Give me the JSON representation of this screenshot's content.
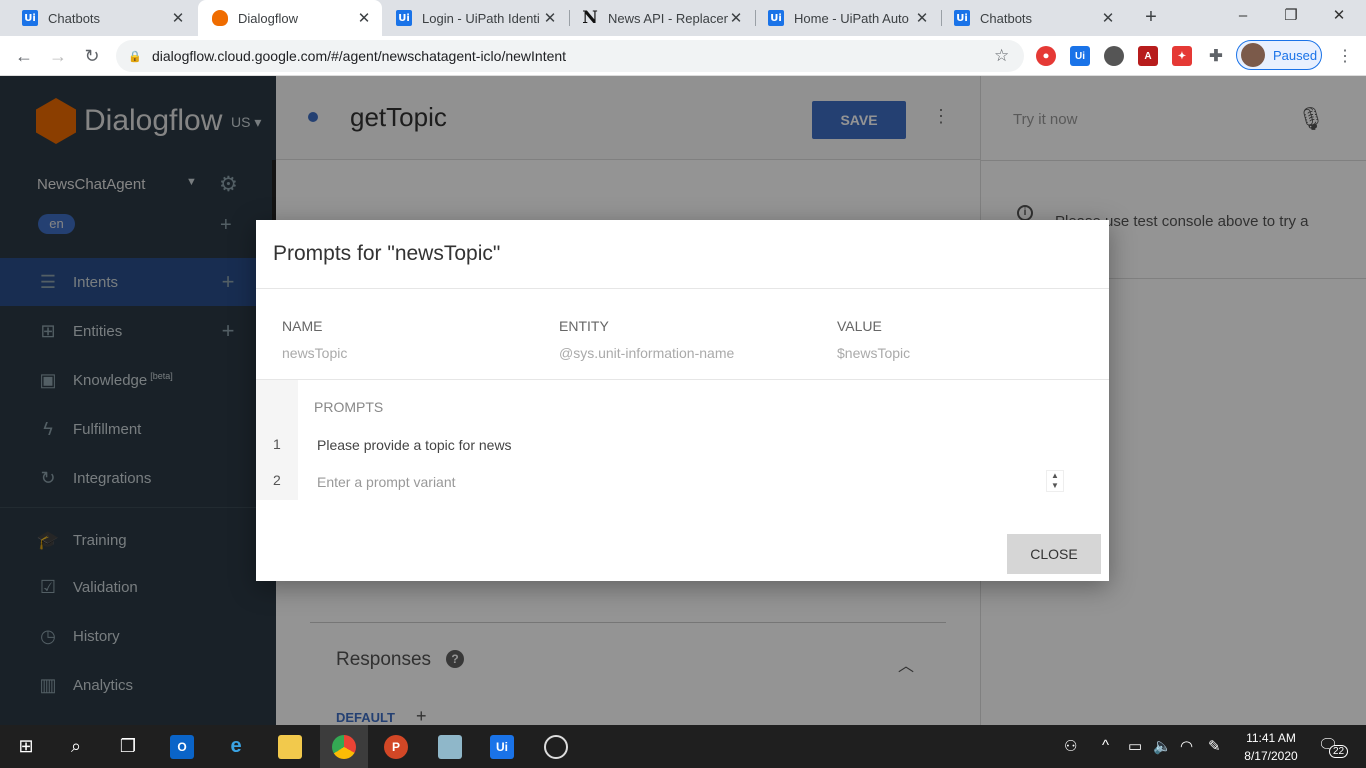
{
  "browser": {
    "tabs": [
      {
        "title": "Chatbots",
        "favicon": "uipath-icon"
      },
      {
        "title": "Dialogflow",
        "favicon": "dialogflow-icon"
      },
      {
        "title": "Login - UiPath Identi",
        "favicon": "uipath-icon"
      },
      {
        "title": "News API - Replacem",
        "favicon": "notion-icon"
      },
      {
        "title": "Home - UiPath Auto",
        "favicon": "uipath-icon"
      },
      {
        "title": "Chatbots",
        "favicon": "uipath-icon"
      }
    ],
    "active_tab_index": 1,
    "url": "dialogflow.cloud.google.com/#/agent/newschatagent-iclo/newIntent",
    "profile_status": "Paused"
  },
  "sidebar": {
    "brand": "Dialogflow",
    "region": "US",
    "agent_name": "NewsChatAgent",
    "language": "en",
    "items": [
      {
        "label": "Intents",
        "icon": "chat-icon",
        "active": true,
        "add": true
      },
      {
        "label": "Entities",
        "icon": "hierarchy-icon",
        "add": true
      },
      {
        "label": "Knowledge",
        "icon": "book-icon",
        "badge": "[beta]"
      },
      {
        "label": "Fulfillment",
        "icon": "bolt-icon"
      },
      {
        "label": "Integrations",
        "icon": "refresh-icon"
      },
      {
        "label": "Training",
        "icon": "graduation-cap-icon"
      },
      {
        "label": "Validation",
        "icon": "checkbox-icon"
      },
      {
        "label": "History",
        "icon": "clock-icon"
      },
      {
        "label": "Analytics",
        "icon": "bar-chart-icon"
      }
    ]
  },
  "main": {
    "intent_name": "getTopic",
    "save_label": "SAVE",
    "responses_label": "Responses",
    "default_tab": "DEFAULT"
  },
  "test_console": {
    "placeholder": "Try it now",
    "hint": "Please use test console above to try a"
  },
  "modal": {
    "title": "Prompts for \"newsTopic\"",
    "columns": {
      "name": "NAME",
      "entity": "ENTITY",
      "value": "VALUE"
    },
    "param": {
      "name": "newsTopic",
      "entity": "@sys.unit-information-name",
      "value": "$newsTopic"
    },
    "prompts_label": "PROMPTS",
    "prompts": [
      {
        "num": "1",
        "text": "Please provide a topic for news"
      },
      {
        "num": "2",
        "placeholder": "Enter a prompt variant"
      }
    ],
    "close_label": "CLOSE"
  },
  "taskbar": {
    "time": "11:41 AM",
    "date": "8/17/2020",
    "notifications": "22",
    "apps": [
      "start",
      "search",
      "task-view",
      "outlook",
      "edge",
      "file-explorer",
      "chrome",
      "powerpoint",
      "notes",
      "uipath",
      "obs"
    ]
  },
  "colors": {
    "accent": "#3f6fc5",
    "sidebar_bg": "#2b3a45",
    "brand_orange": "#ef6c00"
  }
}
